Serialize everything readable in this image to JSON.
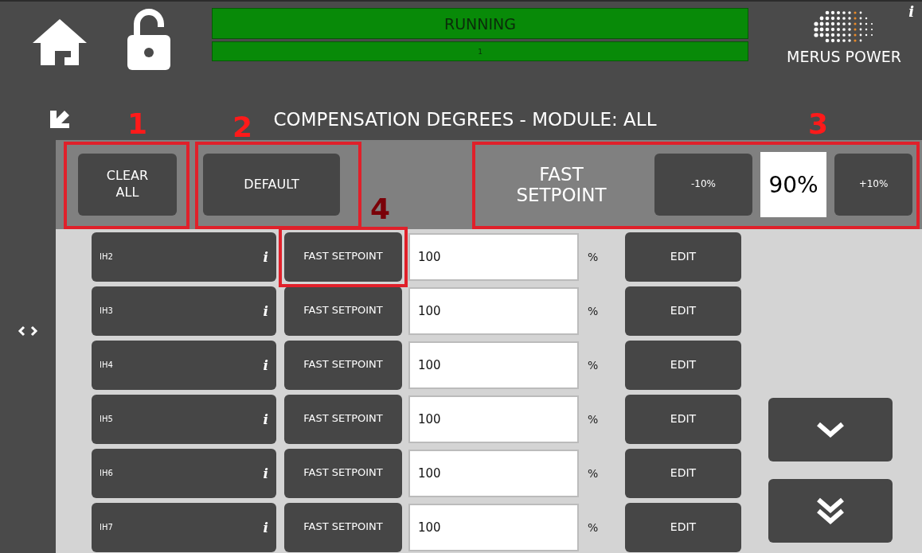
{
  "header": {
    "status": "RUNNING",
    "status_detail": "1",
    "logo": "MERUS POWER",
    "info": "i"
  },
  "title": "COMPENSATION DEGREES - MODULE: ALL",
  "toolbar": {
    "buttons": [
      "CLEAR ALL",
      "DEFAULT"
    ],
    "fast_setpoint": {
      "label": "FAST SETPOINT",
      "decrease": "-10%",
      "value": "90%",
      "increase": "+10%"
    }
  },
  "rows": [
    {
      "name": "IH2",
      "info": "i",
      "mode": "FAST SETPOINT",
      "value": "100",
      "unit": "%",
      "action": "EDIT"
    },
    {
      "name": "IH3",
      "info": "i",
      "mode": "FAST SETPOINT",
      "value": "100",
      "unit": "%",
      "action": "EDIT"
    },
    {
      "name": "IH4",
      "info": "i",
      "mode": "FAST SETPOINT",
      "value": "100",
      "unit": "%",
      "action": "EDIT"
    },
    {
      "name": "IH5",
      "info": "i",
      "mode": "FAST SETPOINT",
      "value": "100",
      "unit": "%",
      "action": "EDIT"
    },
    {
      "name": "IH6",
      "info": "i",
      "mode": "FAST SETPOINT",
      "value": "100",
      "unit": "%",
      "action": "EDIT"
    },
    {
      "name": "IH7",
      "info": "i",
      "mode": "FAST SETPOINT",
      "value": "100",
      "unit": "%",
      "action": "EDIT"
    }
  ],
  "annotations": [
    "1",
    "2",
    "3",
    "4"
  ]
}
